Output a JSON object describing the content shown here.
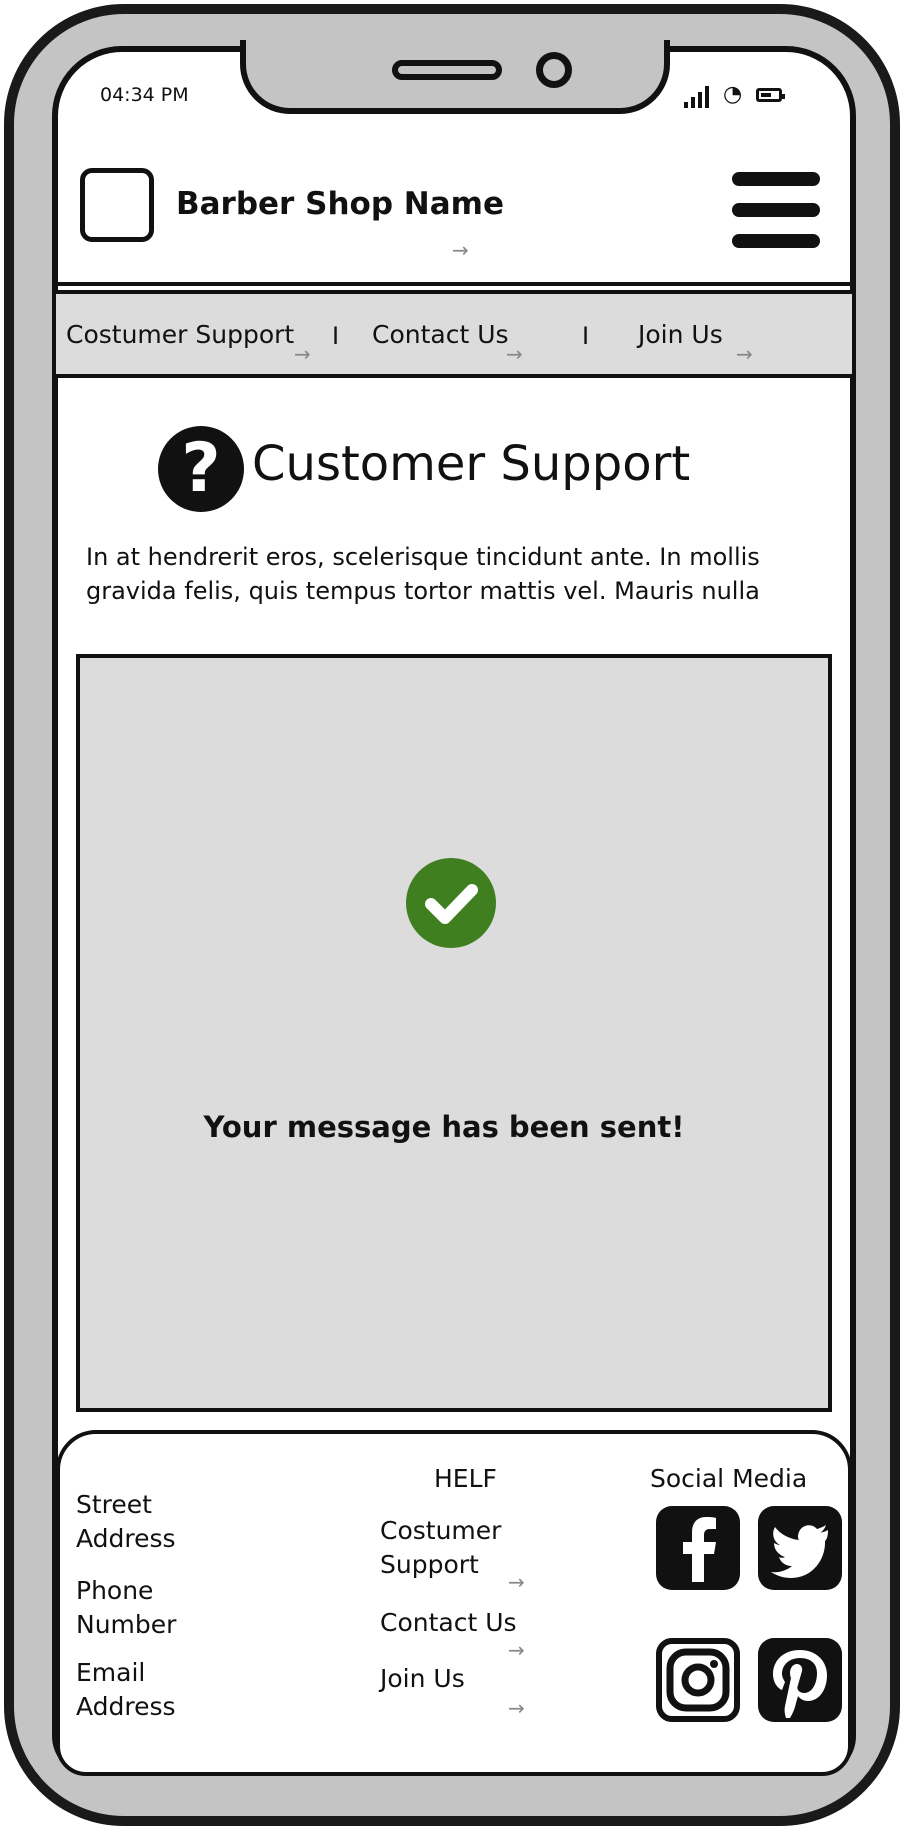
{
  "status_bar": {
    "time": "04:34 PM"
  },
  "header": {
    "shop_name": "Barber Shop Name",
    "link_arrow": "→"
  },
  "nav": {
    "items": [
      "Costumer Support",
      "Contact Us",
      "Join Us"
    ],
    "separator": "I",
    "arrow": "→"
  },
  "page": {
    "title": "Customer Support",
    "title_icon": "question-icon",
    "intro": "In at hendrerit eros, scelerisque tincidunt ante. In mollis gravida felis, quis tempus tortor mattis vel. Mauris nulla"
  },
  "confirmation": {
    "icon": "check-circle-icon",
    "message": "Your message has been sent!",
    "icon_color": "#3f7f1f",
    "panel_color": "#dcdcdc"
  },
  "footer": {
    "address": [
      "Street",
      "Address"
    ],
    "phone": [
      "Phone",
      "Number"
    ],
    "email": [
      "Email",
      "Address"
    ],
    "help_heading": "HELF",
    "help_links": [
      "Costumer",
      "Support",
      "Contact Us",
      "Join Us"
    ],
    "social_heading": "Social Media",
    "social_icons": [
      "facebook-icon",
      "twitter-icon",
      "instagram-icon",
      "pinterest-icon"
    ],
    "arrow": "→"
  }
}
